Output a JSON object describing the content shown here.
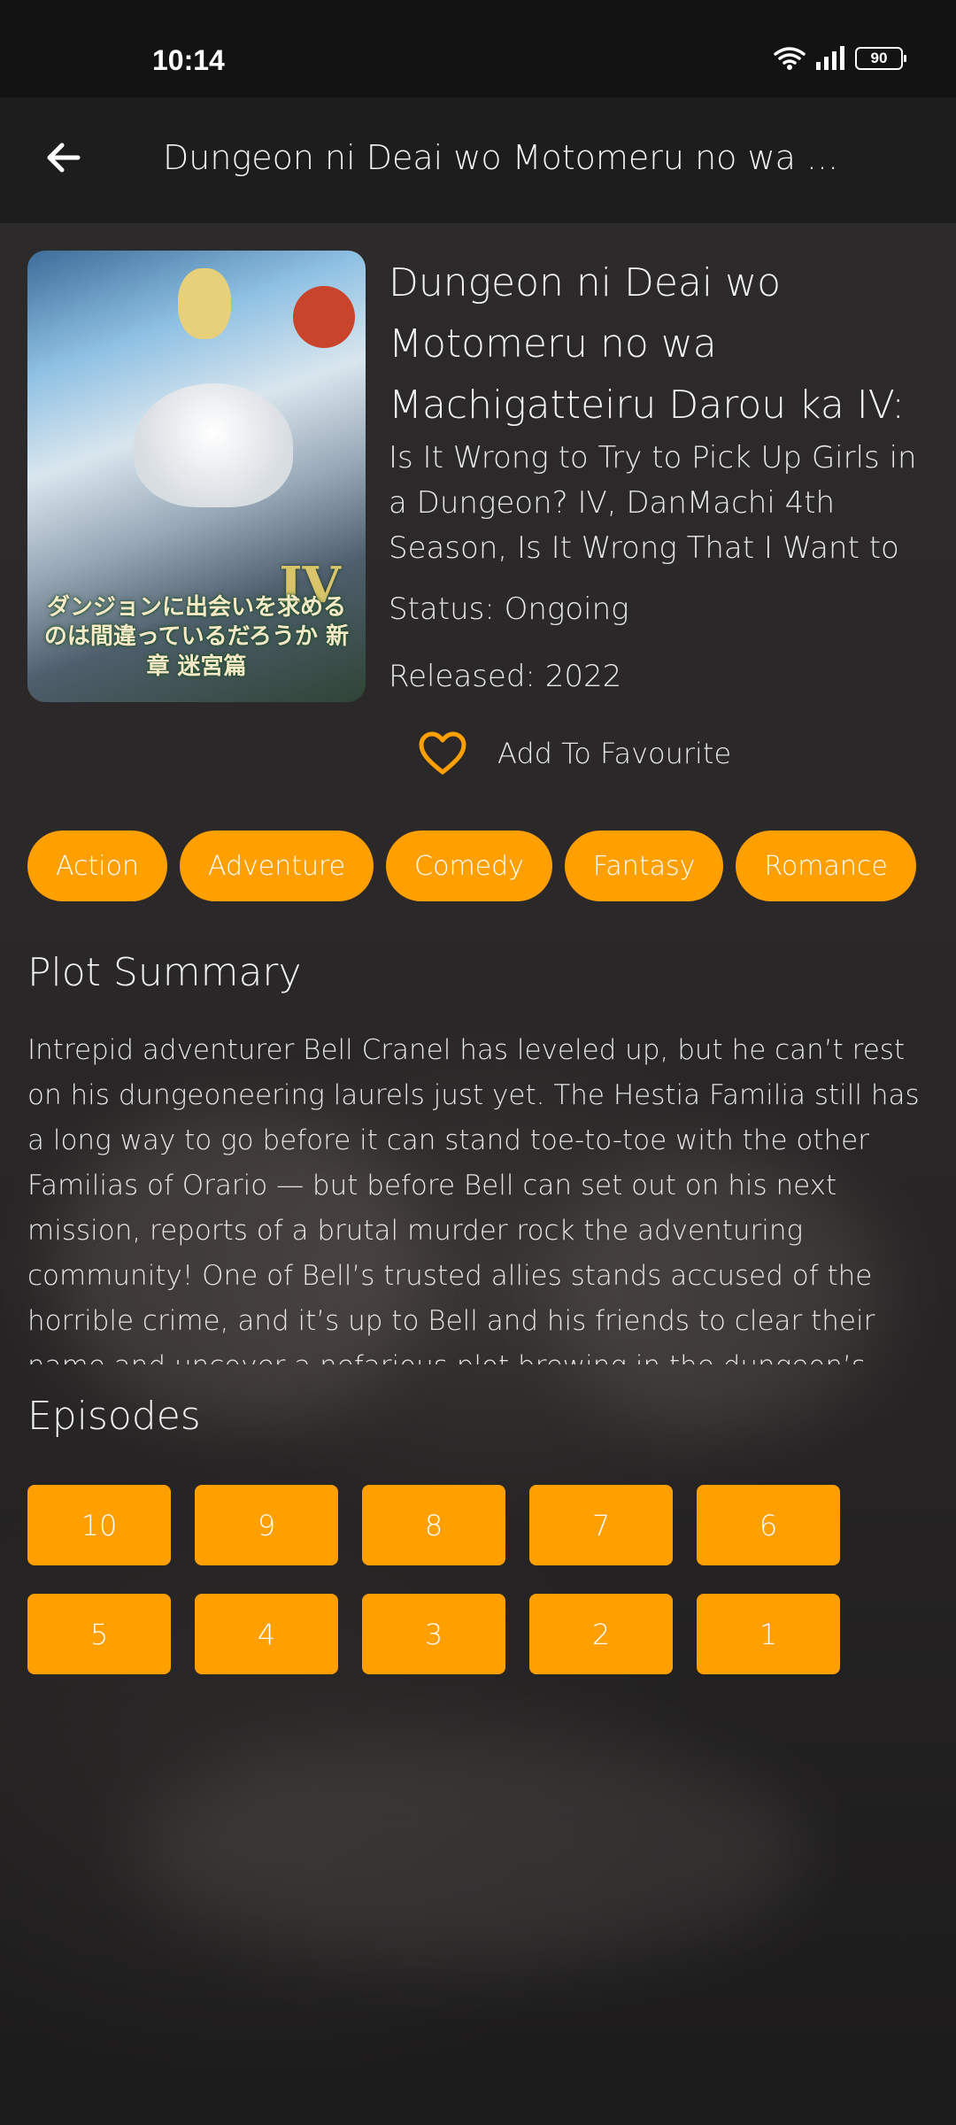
{
  "status_bar": {
    "time": "10:14",
    "battery": "90"
  },
  "app_bar": {
    "title": "Dungeon ni Deai wo Motomeru no wa ...",
    "back_icon": "arrow-left-icon"
  },
  "anime": {
    "title": "Dungeon ni Deai wo Motomeru no wa Machigatteiru Darou ka IV:",
    "alt_titles": "Is It Wrong to Try to Pick Up Girls in a Dungeon? IV, DanMachi 4th Season, Is It Wrong That I Want to Meet You in a",
    "status": "Status: Ongoing",
    "released": "Released: 2022",
    "favourite_label": "Add To Favourite",
    "poster_text": "ダンジョンに出会いを求めるのは間違っているだろうか 新章 迷宮篇",
    "poster_iv": "IV"
  },
  "genres": [
    "Action",
    "Adventure",
    "Comedy",
    "Fantasy",
    "Romance"
  ],
  "plot": {
    "heading": "Plot Summary",
    "text": "Intrepid adventurer Bell Cranel has leveled up, but he can’t rest on his dungeoneering laurels just yet. The Hestia Familia still has a long way to go before it can stand toe-to-toe with the other Familias of Orario — but before Bell can set out on his next mission, reports of a brutal murder rock the adventuring community! One of Bell’s trusted allies stands accused of the horrible crime, and it’s up to Bell and his friends to clear their name and uncover a nefarious plot brewing in the dungeon’s dark depths."
  },
  "episodes": {
    "heading": "Episodes",
    "items": [
      "10",
      "9",
      "8",
      "7",
      "6",
      "5",
      "4",
      "3",
      "2",
      "1"
    ]
  },
  "colors": {
    "accent": "#ff9f00",
    "background": "#2a2828",
    "app_bar": "#1d1d1d"
  }
}
